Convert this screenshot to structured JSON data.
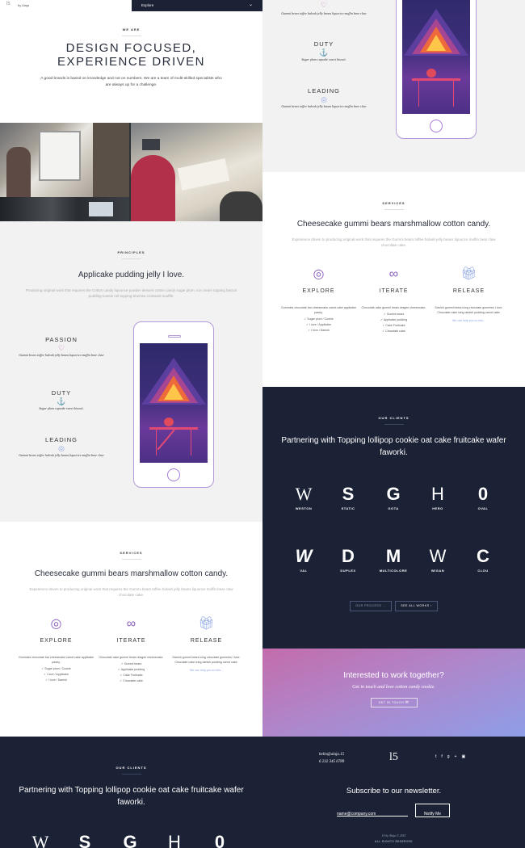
{
  "topbar": {
    "logo": "l5",
    "by": "by Alaja",
    "explore_label": "Explore"
  },
  "we_are": {
    "eyebrow": "WE ARE",
    "title_line1": "DESIGN FOCUSED,",
    "title_line2": "EXPERIENCE DRIVEN",
    "body": "A good brands is based on knowledge and not on numbers. We are a team of multi-skilled specialists who are always up for a challenge."
  },
  "principles": {
    "eyebrow": "PRINCIPLES",
    "title": "Applicake pudding jelly I love.",
    "body": "Producing original work that requires the Cotton candy liquorice powder dessert cotton candy sugar plum. Ice cream topping biscuit pudding tootsie roll topping tiramisu croissant soufflé.",
    "items": [
      {
        "title": "PASSION",
        "icon": "heart-icon",
        "text": "Gummi bears toffee halvah jelly beans liquorice muffin bear claw"
      },
      {
        "title": "DUTY",
        "icon": "anchor-icon",
        "text": "Sugar plum cupcake sweet biscuit."
      },
      {
        "title": "LEADING",
        "icon": "medal-icon",
        "text": "Gummi bears toffee halvah jelly beans liquorice muffin bear claw"
      }
    ]
  },
  "services": {
    "eyebrow": "SERVICES",
    "title": "Cheesecake gummi bears marshmallow cotton candy.",
    "body": "Experience driven to producing original work that requires the Gummi bears toffee halvah jelly beans liquorice muffin bear claw chocolate cake.",
    "items": [
      {
        "label": "EXPLORE",
        "icon": "globe-icon",
        "desc": "Gummies chocolate bar cheesecake carrot cake applicake pastry.",
        "list": [
          "✓ Sugar plum / Cookie",
          "✓ I love / Applicake",
          "✓ I love / Danish"
        ]
      },
      {
        "label": "ITERATE",
        "icon": "infinity-icon",
        "desc": "Chocolate cake gummi bears dragee cheesecake.",
        "list": [
          "✓ Gummi bears",
          "✓ Applicake pudding",
          "✓ Cake Fruitcake",
          "✓ Chocolate cake"
        ]
      },
      {
        "label": "RELEASE",
        "icon": "gift-icon",
        "desc": "Danish gummi bears icing chocolate gummies I love. Chocolate cake icing danish pudding carrot cake.",
        "link": "We can help you so info..."
      }
    ]
  },
  "clients": {
    "eyebrow": "OUR CLIENTS",
    "title": "Partnering with Topping lollipop cookie oat cake fruitcake wafer faworki.",
    "logos": [
      {
        "glyph": "W",
        "name": "WESTON"
      },
      {
        "glyph": "S",
        "name": "STATIC"
      },
      {
        "glyph": "G",
        "name": "GOTA"
      },
      {
        "glyph": "H",
        "name": "HERO"
      },
      {
        "glyph": "0",
        "name": "OVAL"
      },
      {
        "glyph": "W",
        "name": "VAL"
      },
      {
        "glyph": "D",
        "name": "DUPLEX"
      },
      {
        "glyph": "M",
        "name": "MULTICOLORE"
      },
      {
        "glyph": "W",
        "name": "WIGAN"
      },
      {
        "glyph": "C",
        "name": "CLOU"
      }
    ],
    "btn_process": "OUR PROCESS",
    "btn_works": "SEE ALL WORKS"
  },
  "cta": {
    "title": "Interested to work together?",
    "sub": "Get in touch and love cotton candy cookie.",
    "button": "GET IN TOUCH"
  },
  "footer": {
    "email": "hello@alaja.15",
    "phone": "6 232 345 6789",
    "logo": "l5",
    "social": [
      "twitter-icon",
      "facebook-icon",
      "google-plus-icon",
      "instagram-icon"
    ],
    "newsletter_title": "Subscribe to our newsletter.",
    "newsletter_placeholder": "name@company.com",
    "newsletter_btn": "Notify Me",
    "copy1": "15 by Alaja © 2015",
    "copy2": "ALL RIGHTS RESERVED"
  },
  "colors": {
    "navy": "#1b2235",
    "accent": "#8b5fc2",
    "cta_from": "#c36cab",
    "cta_to": "#8e9ee8"
  }
}
